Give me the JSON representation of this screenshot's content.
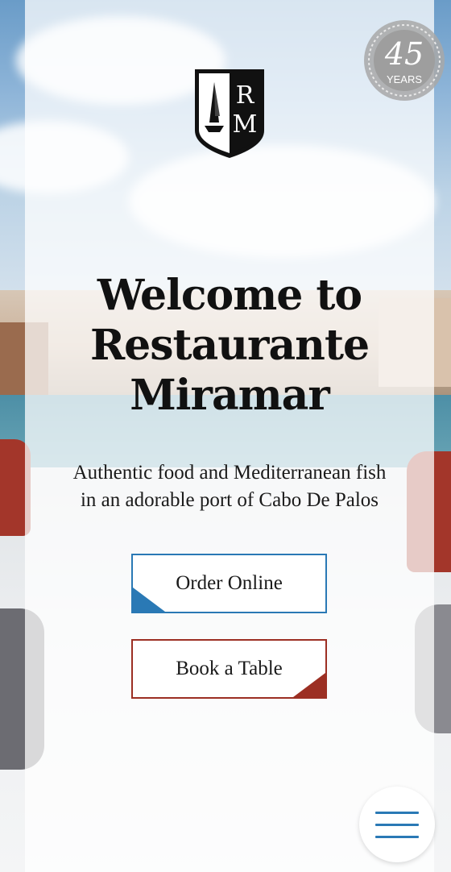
{
  "badge": {
    "number": "45",
    "label": "YEARS"
  },
  "logo": {
    "letter_top": "R",
    "letter_bottom": "M"
  },
  "hero": {
    "title_line1": "Welcome to",
    "title_line2": "Restaurante",
    "title_line3": "Miramar",
    "subtitle_line1": "Authentic food and Mediterranean fish",
    "subtitle_line2": "in an adorable port of Cabo De Palos"
  },
  "buttons": {
    "order_label": "Order Online",
    "book_label": "Book a Table"
  },
  "menu": {
    "icon": "hamburger-menu-icon"
  },
  "colors": {
    "accent_blue": "#2a79b5",
    "accent_red": "#9c2f23",
    "text": "#111111"
  }
}
